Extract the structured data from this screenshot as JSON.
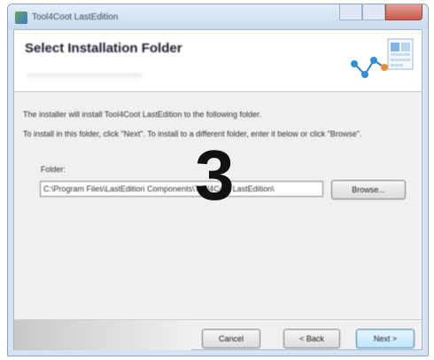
{
  "window": {
    "title": "Tool4Coot LastEdition"
  },
  "header": {
    "title": "Select Installation Folder"
  },
  "body": {
    "line1": "The installer will install Tool4Coot LastEdition to the following folder.",
    "line2": "To install in this folder, click \"Next\". To install to a different folder, enter it below or click \"Browse\"."
  },
  "folder": {
    "label": "Folder:",
    "value": "C:\\Program Files\\LastEdition Components\\Tool4Coot LastEdition\\"
  },
  "buttons": {
    "browse": "Browse...",
    "cancel": "Cancel",
    "back": "< Back",
    "next": "Next >"
  },
  "overlay": {
    "step_number": "3"
  },
  "colors": {
    "accent": "#3c7fb1",
    "graphic_blue": "#2e8fd6"
  }
}
